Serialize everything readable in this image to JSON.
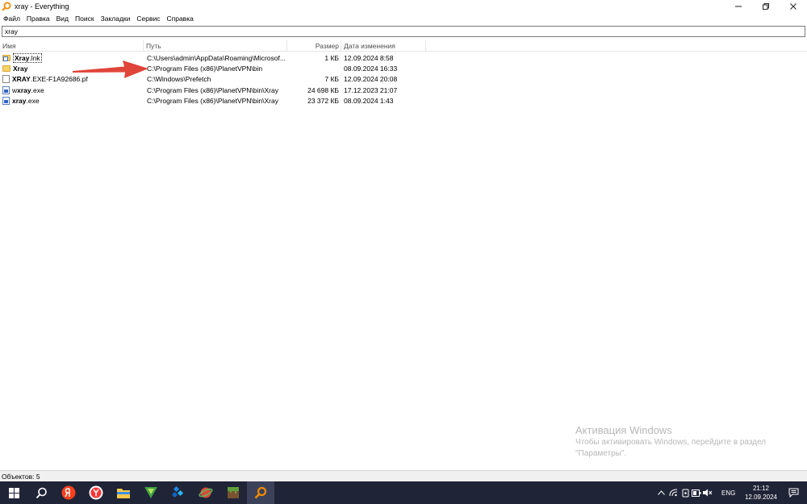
{
  "window": {
    "title": "xray  - Everything"
  },
  "menu": [
    "Файл",
    "Правка",
    "Вид",
    "Поиск",
    "Закладки",
    "Сервис",
    "Справка"
  ],
  "search": {
    "value": "xray"
  },
  "columns": {
    "name": "Имя",
    "path": "Путь",
    "size": "Размер",
    "modified": "Дата изменения"
  },
  "files": [
    {
      "name_bold": "Xray",
      "name_rest": ".lnk",
      "icon": "shortcut-icon",
      "path": "C:\\Users\\admin\\AppData\\Roaming\\Microsof...",
      "size": "1 КБ",
      "modified": "12.09.2024 8:58"
    },
    {
      "name_bold": "Xray",
      "name_rest": "",
      "icon": "folder-icon",
      "path": "C:\\Program Files (x86)\\PlanetVPN\\bin",
      "size": "",
      "modified": "08.09.2024 16:33"
    },
    {
      "name_bold": "XRAY",
      "name_rest": ".EXE-F1A92686.pf",
      "icon": "document-icon",
      "path": "C:\\Windows\\Prefetch",
      "size": "7 КБ",
      "modified": "12.09.2024 20:08"
    },
    {
      "name_pre": "w",
      "name_bold": "xray",
      "name_rest": ".exe",
      "icon": "exe-icon",
      "path": "C:\\Program Files (x86)\\PlanetVPN\\bin\\Xray",
      "size": "24 698 КБ",
      "modified": "17.12.2023 21:07"
    },
    {
      "name_bold": "xray",
      "name_rest": ".exe",
      "icon": "exe-icon",
      "path": "C:\\Program Files (x86)\\PlanetVPN\\bin\\Xray",
      "size": "23 372 КБ",
      "modified": "08.09.2024 1:43"
    }
  ],
  "watermark": {
    "title": "Активация Windows",
    "line1": "Чтобы активировать Windows, перейдите в раздел",
    "line2": "\"Параметры\"."
  },
  "status": {
    "text": "Объектов: 5"
  },
  "taskbar": {
    "lang": "ENG",
    "time": "21:12",
    "date": "12.09.2024"
  },
  "colors": {
    "arrow": "#e0453a",
    "taskbar": "#202437",
    "accent": "#f08a00"
  }
}
